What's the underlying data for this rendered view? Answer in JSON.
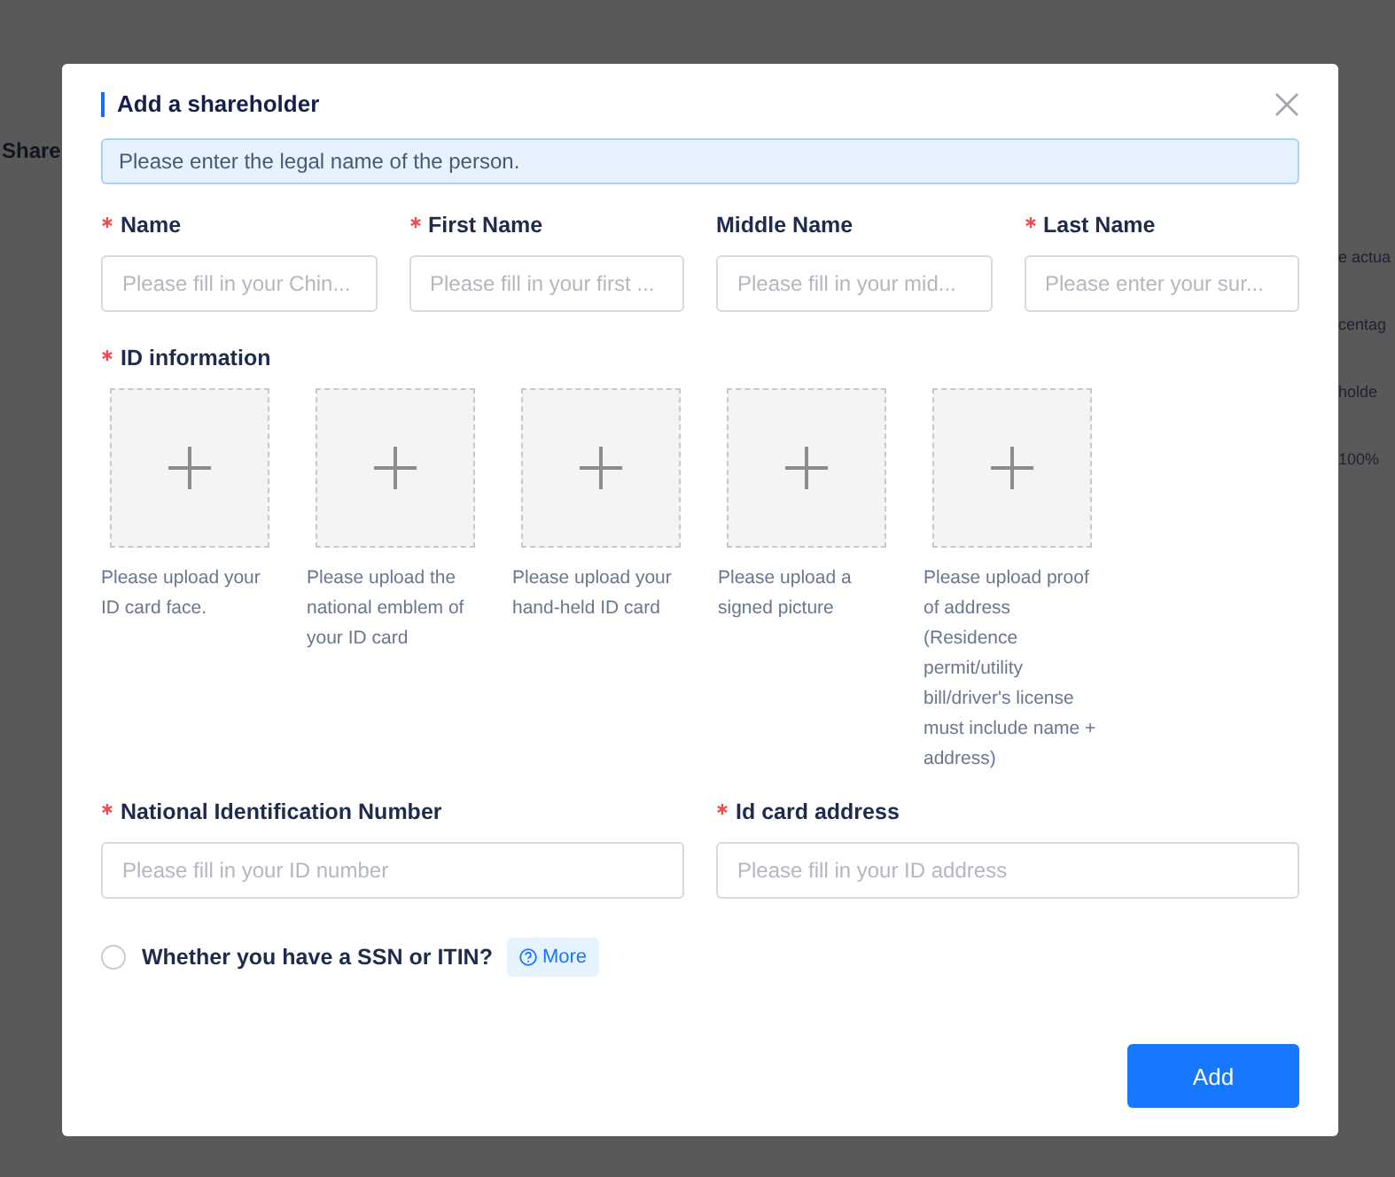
{
  "background": {
    "left_text": "Share",
    "right_texts": [
      "e actua",
      "centag",
      "holde",
      "100%"
    ]
  },
  "dialog": {
    "title": "Add a shareholder",
    "notice": "Please enter the legal name of the person.",
    "name_fields": [
      {
        "label": "Name",
        "required": true,
        "placeholder": "Please fill in your Chin..."
      },
      {
        "label": "First Name",
        "required": true,
        "placeholder": "Please fill in your first ..."
      },
      {
        "label": "Middle Name",
        "required": false,
        "placeholder": "Please fill in your mid..."
      },
      {
        "label": "Last Name",
        "required": true,
        "placeholder": "Please enter your sur..."
      }
    ],
    "id_section": {
      "label": "ID information",
      "required": true,
      "uploads": [
        {
          "caption": "Please upload your ID card face."
        },
        {
          "caption": "Please upload the national emblem of your ID card"
        },
        {
          "caption": "Please upload your hand-held ID card"
        },
        {
          "caption": "Please upload a signed picture"
        },
        {
          "caption": "Please upload proof of address (Residence permit/utility bill/driver's license must include name + address)"
        }
      ]
    },
    "id_fields": [
      {
        "label": "National Identification Number",
        "required": true,
        "placeholder": "Please fill in your ID number"
      },
      {
        "label": "Id card address",
        "required": true,
        "placeholder": "Please fill in your ID address"
      }
    ],
    "ssn": {
      "label": "Whether you have a SSN or ITIN?",
      "checked": false,
      "more": "More"
    },
    "add_button": "Add"
  }
}
